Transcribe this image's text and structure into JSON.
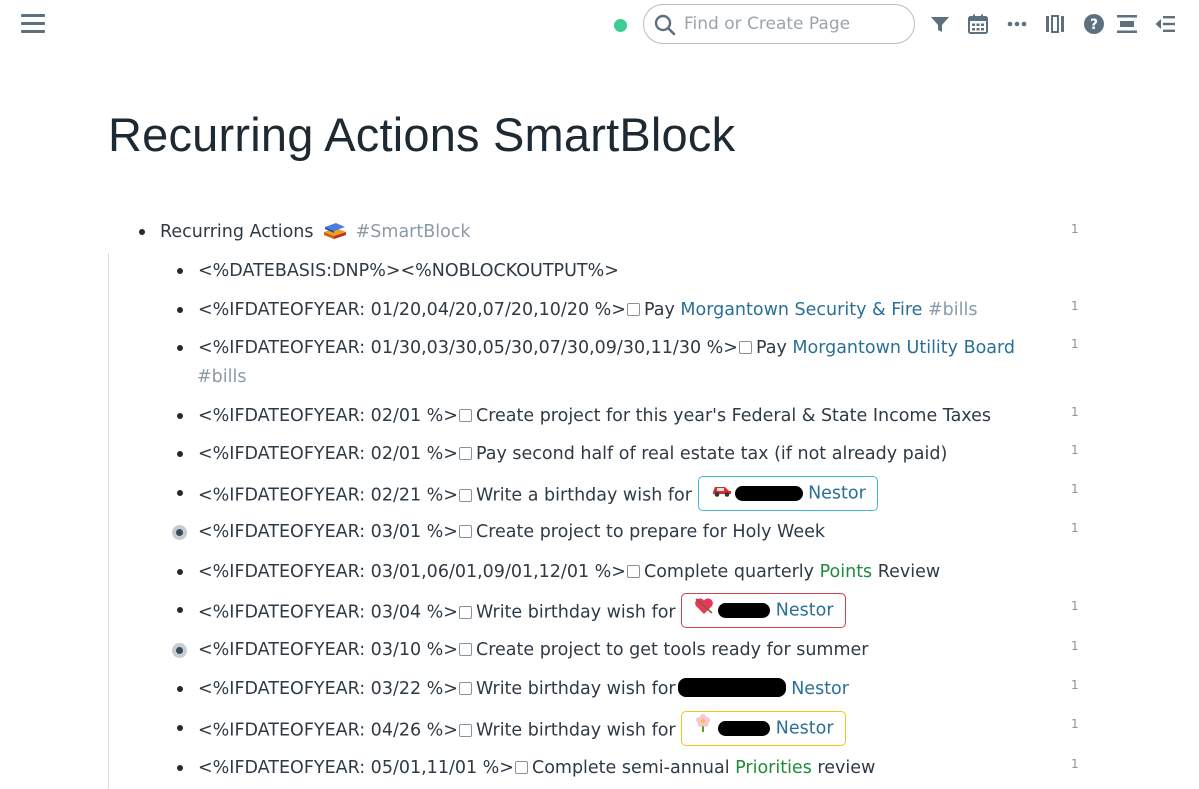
{
  "search": {
    "placeholder": "Find or Create Page"
  },
  "page": {
    "title": "Recurring Actions SmartBlock"
  },
  "blocks": {
    "root": {
      "text": "Recurring Actions",
      "tag": "#SmartBlock",
      "count": "1"
    },
    "b1": {
      "prefix": "<%DATEBASIS:DNP%><%NOBLOCKOUTPUT%>"
    },
    "b2": {
      "prefix": "<%IFDATEOFYEAR: 01/20,04/20,07/20,10/20 %>",
      "text": "Pay",
      "ref": "Morgantown Security & Fire",
      "tag": "#bills",
      "count": "1"
    },
    "b3": {
      "prefix": "<%IFDATEOFYEAR: 01/30,03/30,05/30,07/30,09/30,11/30 %>",
      "text": "Pay",
      "ref": "Morgantown Utility Board",
      "tag": "#bills",
      "count": "1"
    },
    "b4": {
      "prefix": "<%IFDATEOFYEAR: 02/01 %>",
      "text": "Create project for this year's Federal & State Income Taxes",
      "count": "1"
    },
    "b5": {
      "prefix": "<%IFDATEOFYEAR: 02/01 %>",
      "text": "Pay second half of real estate tax (if not already paid)",
      "count": "1"
    },
    "b6": {
      "prefix": "<%IFDATEOFYEAR: 02/21 %>",
      "text": "Write a birthday wish for",
      "person": "Nestor",
      "count": "1"
    },
    "b7": {
      "prefix": "<%IFDATEOFYEAR: 03/01 %>",
      "text": "Create project to prepare for Holy Week",
      "count": "1"
    },
    "b8": {
      "prefix": "<%IFDATEOFYEAR: 03/01,06/01,09/01,12/01 %>",
      "text": "Complete quarterly",
      "ref": "Points",
      "text2": "Review"
    },
    "b9": {
      "prefix": "<%IFDATEOFYEAR: 03/04 %>",
      "text": "Write birthday wish for",
      "person": "Nestor",
      "count": "1"
    },
    "b10": {
      "prefix": "<%IFDATEOFYEAR: 03/10 %>",
      "text": "Create project to get tools ready for summer",
      "count": "1"
    },
    "b11": {
      "prefix": "<%IFDATEOFYEAR: 03/22 %>",
      "text": "Write birthday wish for",
      "person": "Nestor",
      "count": "1"
    },
    "b12": {
      "prefix": "<%IFDATEOFYEAR: 04/26 %>",
      "text": "Write birthday wish for",
      "person": "Nestor",
      "count": "1"
    },
    "b13": {
      "prefix": "<%IFDATEOFYEAR: 05/01,11/01 %>",
      "text": "Complete semi-annual",
      "ref": "Priorities",
      "text2": "review",
      "count": "1"
    }
  },
  "icons": [
    "menu-icon",
    "search-icon",
    "filter-icon",
    "calendar-icon",
    "more-icon",
    "sidebar-icon",
    "help-icon",
    "align-icon",
    "outdent-icon",
    "smartblock-emoji",
    "car-emoji",
    "heart-emoji",
    "flower-emoji"
  ],
  "colors": {
    "sync": "#3dcc91",
    "page_ref": "#2a6f97",
    "tag": "#8a9aa8",
    "green_ref": "#1f8a3a",
    "pill_teal": "#3fbcd1",
    "pill_red": "#d24052",
    "pill_yellow": "#f0c419"
  }
}
